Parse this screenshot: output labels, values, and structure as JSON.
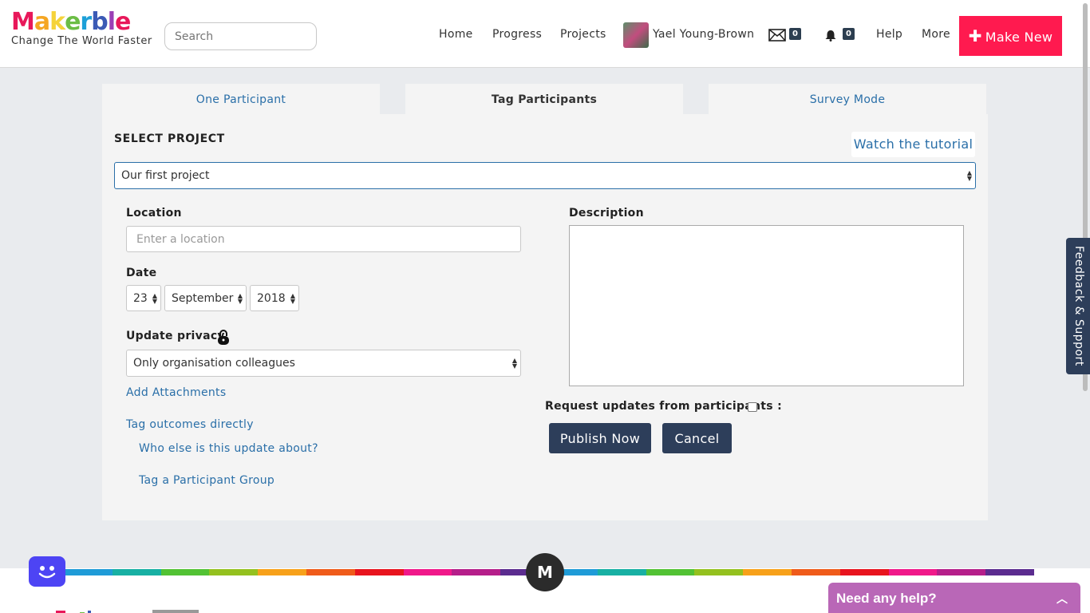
{
  "header": {
    "logo_text": "Makerble",
    "tagline": "Change The World Faster",
    "search_placeholder": "Search",
    "nav": [
      "Home",
      "Progress",
      "Projects"
    ],
    "user_name": "Yael Young-Brown",
    "messages_count": "0",
    "notifications_count": "0",
    "help": "Help",
    "more": "More",
    "make_new": "Make New"
  },
  "tabs": [
    {
      "label": "One Participant",
      "active": false
    },
    {
      "label": "Tag Participants",
      "active": true
    },
    {
      "label": "Survey Mode",
      "active": false
    }
  ],
  "form": {
    "select_project_label": "SELECT PROJECT",
    "tutorial_link": "Watch the tutorial",
    "project_value": "Our first project",
    "location_label": "Location",
    "location_placeholder": "Enter a location",
    "date_label": "Date",
    "date_day": "23",
    "date_month": "September",
    "date_year": "2018",
    "privacy_label": "Update privacy",
    "privacy_value": "Only organisation colleagues",
    "add_attachments": "Add Attachments",
    "tag_outcomes": "Tag outcomes directly",
    "who_else": "Who else is this update about?",
    "tag_group": "Tag a Participant Group",
    "description_label": "Description",
    "request_updates_label": "Request updates from participants :",
    "publish": "Publish Now",
    "cancel": "Cancel"
  },
  "sidebar": {
    "feedback": "Feedback & Support"
  },
  "footer": {
    "m_letter": "M",
    "help_widget": "Need any help?"
  },
  "colors": {
    "brand_red": "#ff1a4f",
    "link_blue": "#2a6fa8",
    "dark_button": "#2d3e5a",
    "help_purple": "#b967b7",
    "bot_blue": "#4d44f4"
  }
}
